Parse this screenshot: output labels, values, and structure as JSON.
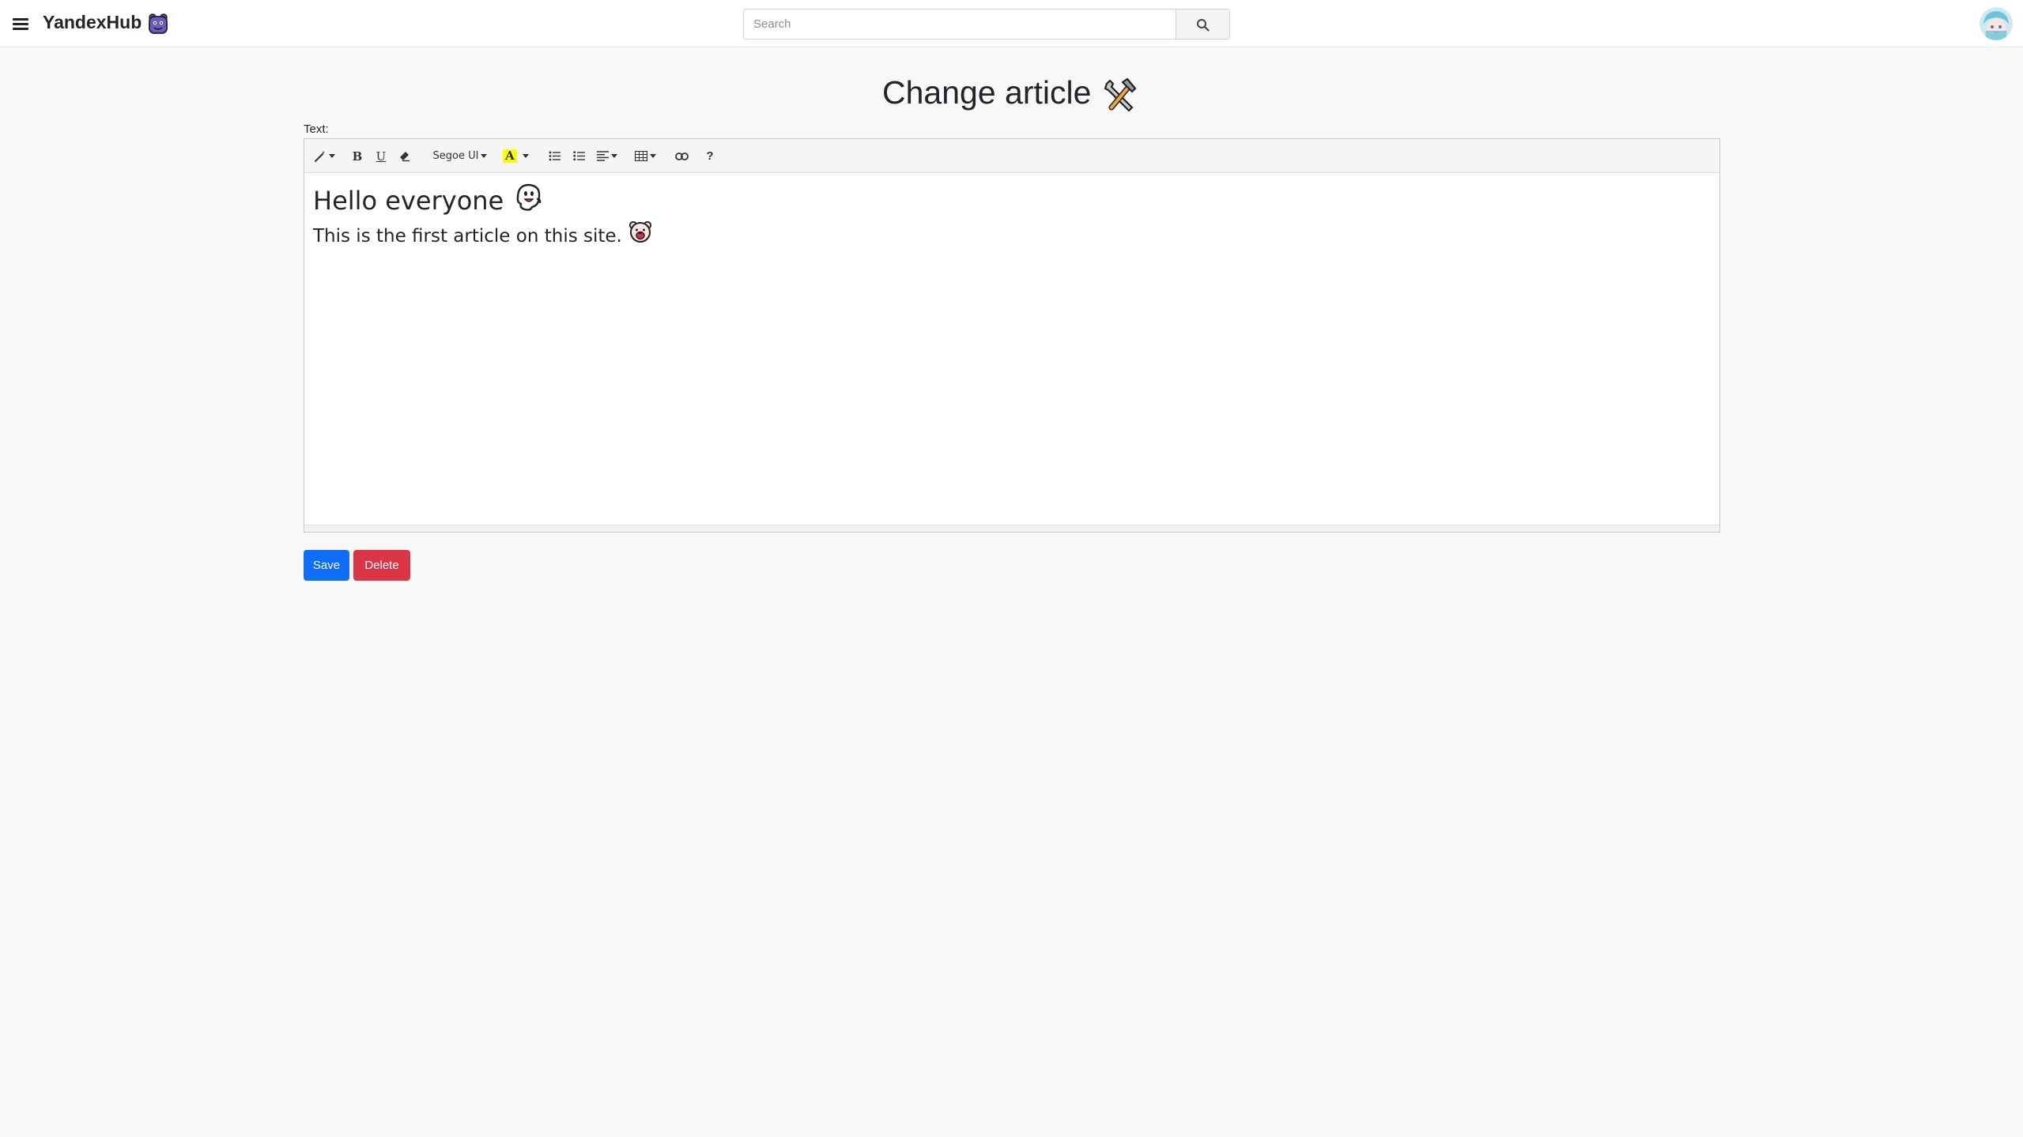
{
  "navbar": {
    "brand": "YandexHub",
    "search_placeholder": "Search"
  },
  "page": {
    "title": "Change article",
    "text_label": "Text:"
  },
  "toolbar": {
    "font_name": "Segoe UI",
    "help": "?",
    "bold": "B",
    "underline": "U",
    "color_letter": "A",
    "highlight_color": "#ffff00"
  },
  "content": {
    "heading": "Hello everyone",
    "paragraph": "This is the first article on this site."
  },
  "actions": {
    "save": "Save",
    "delete": "Delete"
  },
  "colors": {
    "primary": "#0d6efd",
    "danger": "#dc3545"
  }
}
